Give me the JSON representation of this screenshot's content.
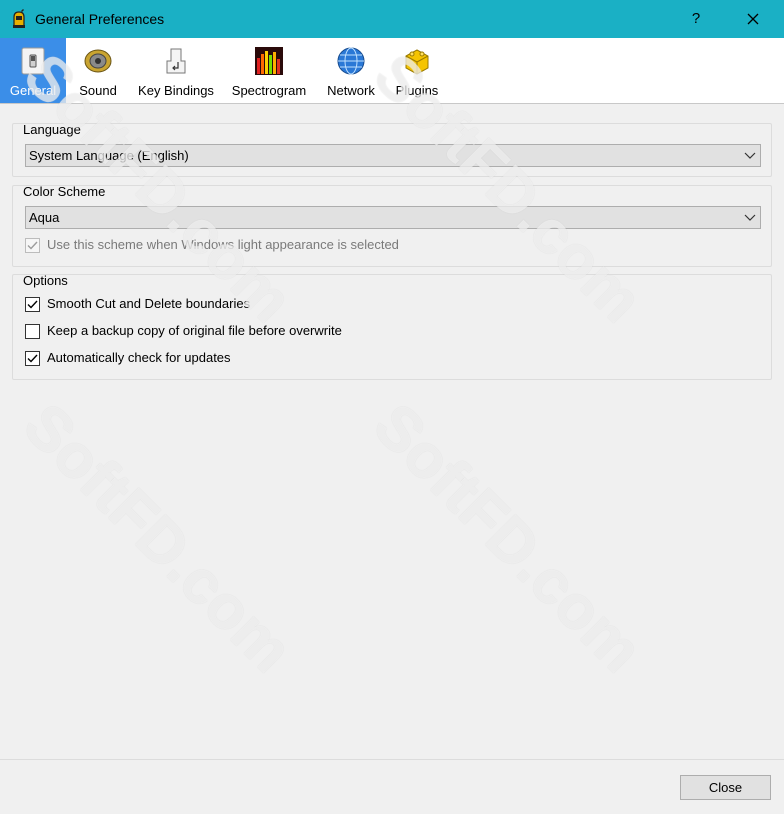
{
  "window": {
    "title": "General Preferences",
    "help_label": "?"
  },
  "tabs": [
    {
      "label": "General",
      "icon": "switch-icon",
      "active": true
    },
    {
      "label": "Sound",
      "icon": "speaker-icon"
    },
    {
      "label": "Key Bindings",
      "icon": "key-icon"
    },
    {
      "label": "Spectrogram",
      "icon": "spectrogram-icon"
    },
    {
      "label": "Network",
      "icon": "globe-icon"
    },
    {
      "label": "Plugins",
      "icon": "plugin-icon"
    }
  ],
  "language": {
    "group_title": "Language",
    "selected": "System Language (English)"
  },
  "color_scheme": {
    "group_title": "Color Scheme",
    "selected": "Aqua",
    "light_appearance_label": "Use this scheme when Windows light appearance is selected",
    "light_appearance_checked": true,
    "light_appearance_enabled": false
  },
  "options": {
    "group_title": "Options",
    "items": [
      {
        "label": "Smooth Cut and Delete boundaries",
        "checked": true
      },
      {
        "label": "Keep a backup copy of original file before overwrite",
        "checked": false
      },
      {
        "label": "Automatically check for updates",
        "checked": true
      }
    ]
  },
  "footer": {
    "close_label": "Close"
  },
  "watermark": "SoftFD.com",
  "colors": {
    "titlebar": "#1ab0c5",
    "active_tab": "#3b8ee8",
    "background": "#f0f0f0"
  }
}
